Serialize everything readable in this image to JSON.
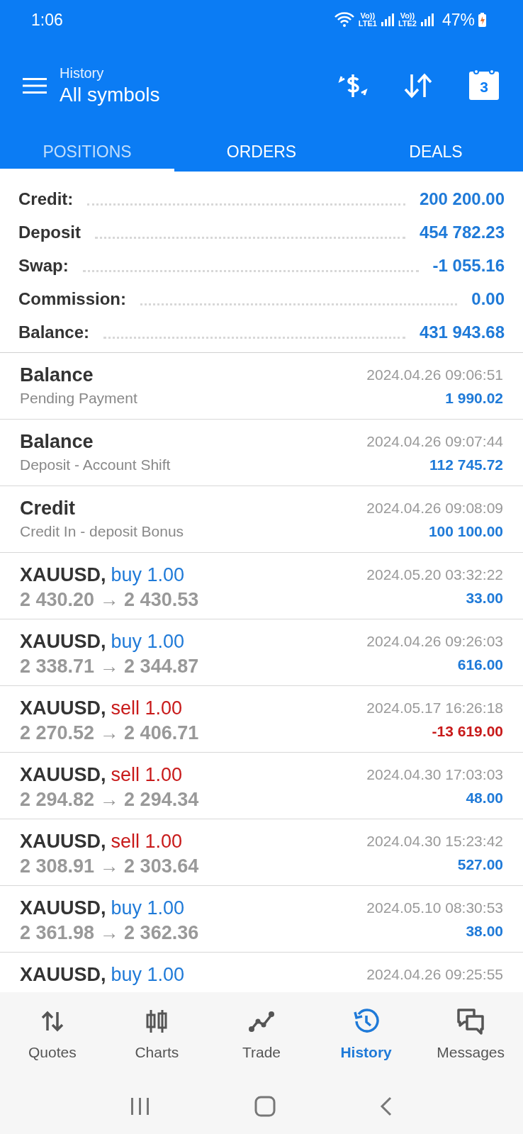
{
  "status_bar": {
    "time": "1:06",
    "sim1": [
      "Vo))",
      "LTE1"
    ],
    "sim2": [
      "Vo))",
      "LTE2"
    ],
    "battery": "47%"
  },
  "header": {
    "subtitle": "History",
    "title": "All symbols",
    "calendar_day": "3"
  },
  "tabs": [
    {
      "label": "POSITIONS",
      "selected": true
    },
    {
      "label": "ORDERS",
      "selected": false
    },
    {
      "label": "DEALS",
      "selected": false
    }
  ],
  "summary": [
    {
      "label": "Credit:",
      "value": "200 200.00"
    },
    {
      "label": "Deposit",
      "value": "454 782.23"
    },
    {
      "label": "Swap:",
      "value": "-1 055.16"
    },
    {
      "label": "Commission:",
      "value": "0.00"
    },
    {
      "label": "Balance:",
      "value": "431 943.68"
    }
  ],
  "rows": [
    {
      "kind": "operation",
      "title": "Balance",
      "comment": "Pending Payment",
      "time": "2024.04.26 09:06:51",
      "amount": "1 990.02",
      "loss": false
    },
    {
      "kind": "operation",
      "title": "Balance",
      "comment": "Deposit - Account Shift",
      "time": "2024.04.26 09:07:44",
      "amount": "112 745.72",
      "loss": false
    },
    {
      "kind": "operation",
      "title": "Credit",
      "comment": "Credit In - deposit Bonus",
      "time": "2024.04.26 09:08:09",
      "amount": "100 100.00",
      "loss": false
    },
    {
      "kind": "trade",
      "symbol": "XAUUSD,",
      "side": "buy",
      "volume": "1.00",
      "short": false,
      "prices": "2 430.20 → 2 430.53",
      "time": "2024.05.20 03:32:22",
      "amount": "33.00",
      "loss": false
    },
    {
      "kind": "trade",
      "symbol": "XAUUSD,",
      "side": "buy",
      "volume": "1.00",
      "short": false,
      "prices": "2 338.71 → 2 344.87",
      "time": "2024.04.26 09:26:03",
      "amount": "616.00",
      "loss": false
    },
    {
      "kind": "trade",
      "symbol": "XAUUSD,",
      "side": "sell",
      "volume": "1.00",
      "short": true,
      "prices": "2 270.52 → 2 406.71",
      "time": "2024.05.17 16:26:18",
      "amount": "-13 619.00",
      "loss": true
    },
    {
      "kind": "trade",
      "symbol": "XAUUSD,",
      "side": "sell",
      "volume": "1.00",
      "short": true,
      "prices": "2 294.82 → 2 294.34",
      "time": "2024.04.30 17:03:03",
      "amount": "48.00",
      "loss": false
    },
    {
      "kind": "trade",
      "symbol": "XAUUSD,",
      "side": "sell",
      "volume": "1.00",
      "short": true,
      "prices": "2 308.91 → 2 303.64",
      "time": "2024.04.30 15:23:42",
      "amount": "527.00",
      "loss": false
    },
    {
      "kind": "trade",
      "symbol": "XAUUSD,",
      "side": "buy",
      "volume": "1.00",
      "short": false,
      "prices": "2 361.98 → 2 362.36",
      "time": "2024.05.10 08:30:53",
      "amount": "38.00",
      "loss": false
    },
    {
      "kind": "trade",
      "symbol": "XAUUSD,",
      "side": "buy",
      "volume": "1.00",
      "short": false,
      "time": "2024.04.26 09:25:55"
    }
  ],
  "bottom_nav": [
    {
      "label": "Quotes",
      "selected": false
    },
    {
      "label": "Charts",
      "selected": false
    },
    {
      "label": "Trade",
      "selected": false
    },
    {
      "label": "History",
      "selected": true
    },
    {
      "label": "Messages",
      "selected": false
    }
  ]
}
